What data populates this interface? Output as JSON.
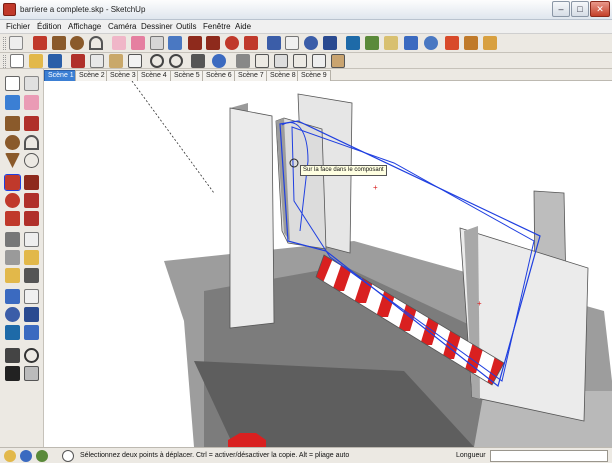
{
  "window": {
    "title": "barriere a complete.skp - SketchUp",
    "minimize": "–",
    "maximize": "□",
    "close": "✕"
  },
  "menu": [
    "Fichier",
    "Édition",
    "Affichage",
    "Caméra",
    "Dessiner",
    "Outils",
    "Fenêtre",
    "Aide"
  ],
  "scenes": [
    "Scène 1",
    "Scène 2",
    "Scène 3",
    "Scène 4",
    "Scène 5",
    "Scène 6",
    "Scène 7",
    "Scène 8",
    "Scène 9"
  ],
  "active_scene": "Scène 1",
  "tooltip": "Sur la face dans le composant",
  "status": {
    "message": "Sélectionnez deux points à déplacer. Ctrl = activer/désactiver la copie. Alt = pliage auto",
    "measure_label": "Longueur",
    "measure_value": ""
  },
  "colors": {
    "selection": "#1f3fe0",
    "stripe_red": "#d92020",
    "active_tab": "#3b7fd4"
  }
}
